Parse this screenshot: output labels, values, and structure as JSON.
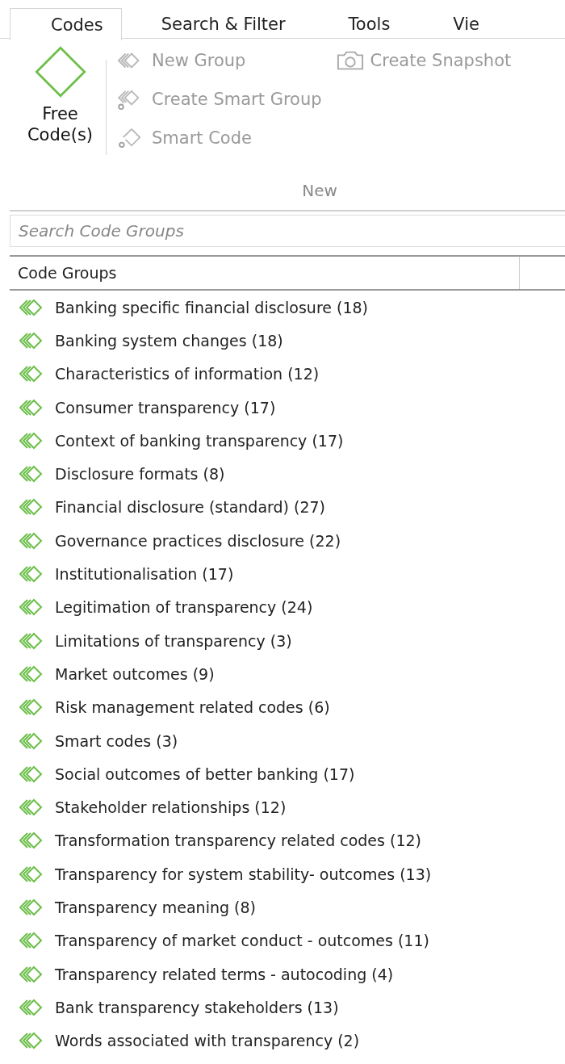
{
  "tabs": [
    {
      "label": "Codes",
      "selected": true
    },
    {
      "label": "Search & Filter",
      "selected": false
    },
    {
      "label": "Tools",
      "selected": false
    },
    {
      "label": "Vie",
      "selected": false
    }
  ],
  "ribbon": {
    "large_button": {
      "label": "Free Code(s)",
      "kind": "code",
      "disabled": false
    },
    "columns": [
      [
        {
          "label": "New Group",
          "kind": "group",
          "disabled": true
        },
        {
          "label": "Create Smart Group",
          "kind": "smart-group",
          "disabled": true
        },
        {
          "label": "Smart Code",
          "kind": "smart-code",
          "disabled": true
        }
      ],
      [
        {
          "label": "Create Snapshot",
          "kind": "snapshot",
          "disabled": true
        }
      ]
    ],
    "group_label": "New"
  },
  "search": {
    "placeholder": "Search Code Groups"
  },
  "table": {
    "columns": [
      "Code Groups"
    ],
    "rows": [
      "Banking specific financial disclosure (18)",
      "Banking system changes (18)",
      "Characteristics of information (12)",
      "Consumer transparency (17)",
      "Context of banking transparency (17)",
      "Disclosure formats (8)",
      "Financial  disclosure (standard) (27)",
      "Governance practices disclosure (22)",
      "Institutionalisation (17)",
      "Legitimation of transparency (24)",
      "Limitations of transparency (3)",
      "Market outcomes (9)",
      "Risk management related codes (6)",
      "Smart codes (3)",
      "Social outcomes of better banking (17)",
      "Stakeholder relationships (12)",
      "Transformation transparency related codes (12)",
      "Transparency for system stability- outcomes (13)",
      "Transparency meaning (8)",
      "Transparency of market conduct - outcomes (11)",
      "Transparency related terms - autocoding (4)",
      "Bank transparency stakeholders (13)",
      "Words associated with transparency (2)"
    ]
  }
}
